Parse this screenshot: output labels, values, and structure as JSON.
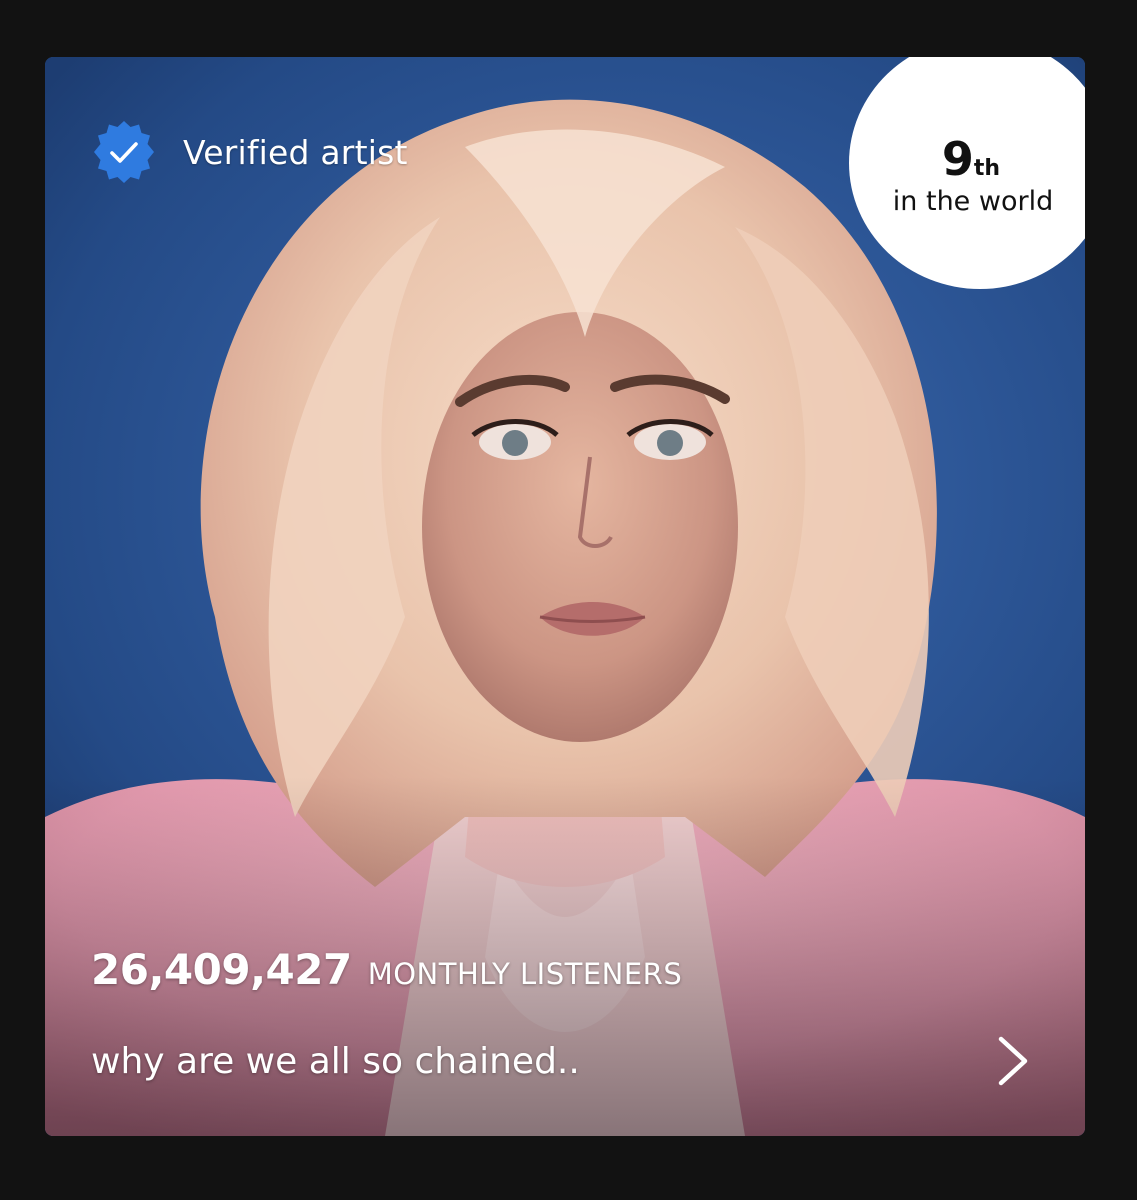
{
  "artist_card": {
    "verified_label": "Verified artist",
    "icon": "verified-badge-icon",
    "rank": {
      "number": "9",
      "suffix": "th",
      "caption": "in the world"
    },
    "monthly_listeners": {
      "count": "26,409,427",
      "label": "MONTHLY LISTENERS"
    },
    "bio": "why are we all so chained..",
    "colors": {
      "badge_blue": "#2f7be0",
      "backdrop_blue": "#2e5899",
      "page_background": "#121212"
    }
  }
}
